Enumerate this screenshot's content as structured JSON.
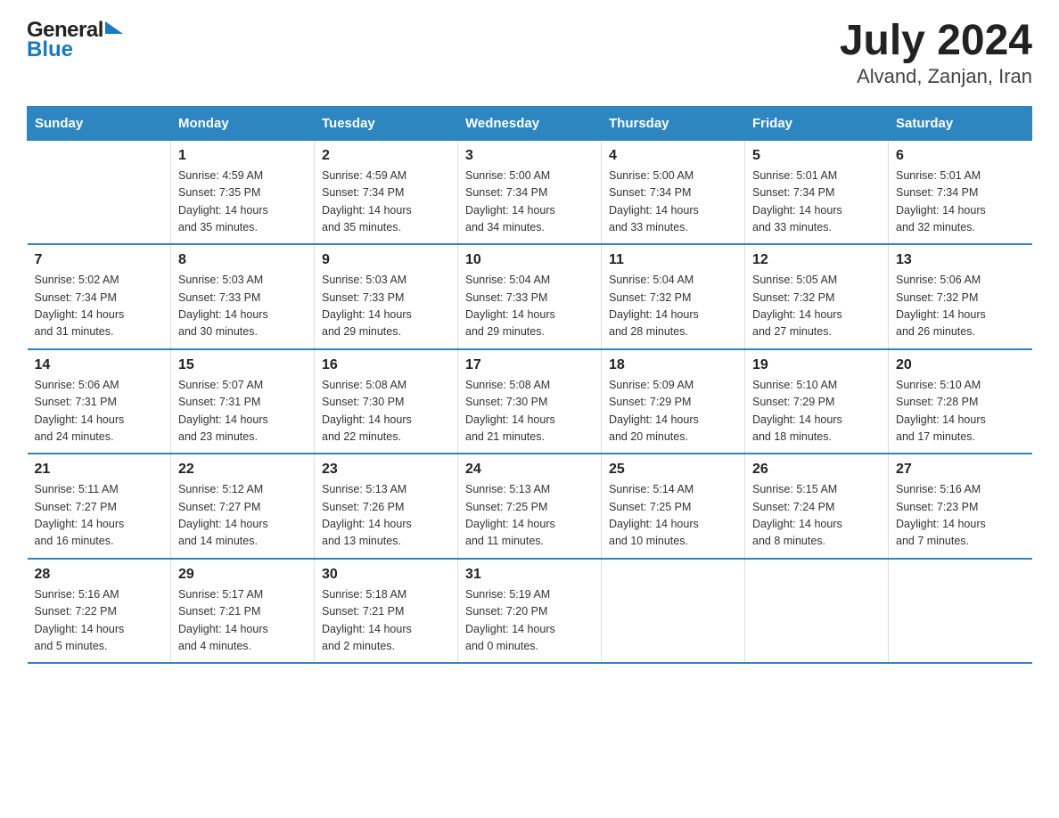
{
  "header": {
    "logo_general": "General",
    "logo_blue": "Blue",
    "title": "July 2024",
    "subtitle": "Alvand, Zanjan, Iran"
  },
  "calendar": {
    "days_of_week": [
      "Sunday",
      "Monday",
      "Tuesday",
      "Wednesday",
      "Thursday",
      "Friday",
      "Saturday"
    ],
    "weeks": [
      [
        {
          "day": "",
          "info": ""
        },
        {
          "day": "1",
          "info": "Sunrise: 4:59 AM\nSunset: 7:35 PM\nDaylight: 14 hours\nand 35 minutes."
        },
        {
          "day": "2",
          "info": "Sunrise: 4:59 AM\nSunset: 7:34 PM\nDaylight: 14 hours\nand 35 minutes."
        },
        {
          "day": "3",
          "info": "Sunrise: 5:00 AM\nSunset: 7:34 PM\nDaylight: 14 hours\nand 34 minutes."
        },
        {
          "day": "4",
          "info": "Sunrise: 5:00 AM\nSunset: 7:34 PM\nDaylight: 14 hours\nand 33 minutes."
        },
        {
          "day": "5",
          "info": "Sunrise: 5:01 AM\nSunset: 7:34 PM\nDaylight: 14 hours\nand 33 minutes."
        },
        {
          "day": "6",
          "info": "Sunrise: 5:01 AM\nSunset: 7:34 PM\nDaylight: 14 hours\nand 32 minutes."
        }
      ],
      [
        {
          "day": "7",
          "info": "Sunrise: 5:02 AM\nSunset: 7:34 PM\nDaylight: 14 hours\nand 31 minutes."
        },
        {
          "day": "8",
          "info": "Sunrise: 5:03 AM\nSunset: 7:33 PM\nDaylight: 14 hours\nand 30 minutes."
        },
        {
          "day": "9",
          "info": "Sunrise: 5:03 AM\nSunset: 7:33 PM\nDaylight: 14 hours\nand 29 minutes."
        },
        {
          "day": "10",
          "info": "Sunrise: 5:04 AM\nSunset: 7:33 PM\nDaylight: 14 hours\nand 29 minutes."
        },
        {
          "day": "11",
          "info": "Sunrise: 5:04 AM\nSunset: 7:32 PM\nDaylight: 14 hours\nand 28 minutes."
        },
        {
          "day": "12",
          "info": "Sunrise: 5:05 AM\nSunset: 7:32 PM\nDaylight: 14 hours\nand 27 minutes."
        },
        {
          "day": "13",
          "info": "Sunrise: 5:06 AM\nSunset: 7:32 PM\nDaylight: 14 hours\nand 26 minutes."
        }
      ],
      [
        {
          "day": "14",
          "info": "Sunrise: 5:06 AM\nSunset: 7:31 PM\nDaylight: 14 hours\nand 24 minutes."
        },
        {
          "day": "15",
          "info": "Sunrise: 5:07 AM\nSunset: 7:31 PM\nDaylight: 14 hours\nand 23 minutes."
        },
        {
          "day": "16",
          "info": "Sunrise: 5:08 AM\nSunset: 7:30 PM\nDaylight: 14 hours\nand 22 minutes."
        },
        {
          "day": "17",
          "info": "Sunrise: 5:08 AM\nSunset: 7:30 PM\nDaylight: 14 hours\nand 21 minutes."
        },
        {
          "day": "18",
          "info": "Sunrise: 5:09 AM\nSunset: 7:29 PM\nDaylight: 14 hours\nand 20 minutes."
        },
        {
          "day": "19",
          "info": "Sunrise: 5:10 AM\nSunset: 7:29 PM\nDaylight: 14 hours\nand 18 minutes."
        },
        {
          "day": "20",
          "info": "Sunrise: 5:10 AM\nSunset: 7:28 PM\nDaylight: 14 hours\nand 17 minutes."
        }
      ],
      [
        {
          "day": "21",
          "info": "Sunrise: 5:11 AM\nSunset: 7:27 PM\nDaylight: 14 hours\nand 16 minutes."
        },
        {
          "day": "22",
          "info": "Sunrise: 5:12 AM\nSunset: 7:27 PM\nDaylight: 14 hours\nand 14 minutes."
        },
        {
          "day": "23",
          "info": "Sunrise: 5:13 AM\nSunset: 7:26 PM\nDaylight: 14 hours\nand 13 minutes."
        },
        {
          "day": "24",
          "info": "Sunrise: 5:13 AM\nSunset: 7:25 PM\nDaylight: 14 hours\nand 11 minutes."
        },
        {
          "day": "25",
          "info": "Sunrise: 5:14 AM\nSunset: 7:25 PM\nDaylight: 14 hours\nand 10 minutes."
        },
        {
          "day": "26",
          "info": "Sunrise: 5:15 AM\nSunset: 7:24 PM\nDaylight: 14 hours\nand 8 minutes."
        },
        {
          "day": "27",
          "info": "Sunrise: 5:16 AM\nSunset: 7:23 PM\nDaylight: 14 hours\nand 7 minutes."
        }
      ],
      [
        {
          "day": "28",
          "info": "Sunrise: 5:16 AM\nSunset: 7:22 PM\nDaylight: 14 hours\nand 5 minutes."
        },
        {
          "day": "29",
          "info": "Sunrise: 5:17 AM\nSunset: 7:21 PM\nDaylight: 14 hours\nand 4 minutes."
        },
        {
          "day": "30",
          "info": "Sunrise: 5:18 AM\nSunset: 7:21 PM\nDaylight: 14 hours\nand 2 minutes."
        },
        {
          "day": "31",
          "info": "Sunrise: 5:19 AM\nSunset: 7:20 PM\nDaylight: 14 hours\nand 0 minutes."
        },
        {
          "day": "",
          "info": ""
        },
        {
          "day": "",
          "info": ""
        },
        {
          "day": "",
          "info": ""
        }
      ]
    ]
  }
}
